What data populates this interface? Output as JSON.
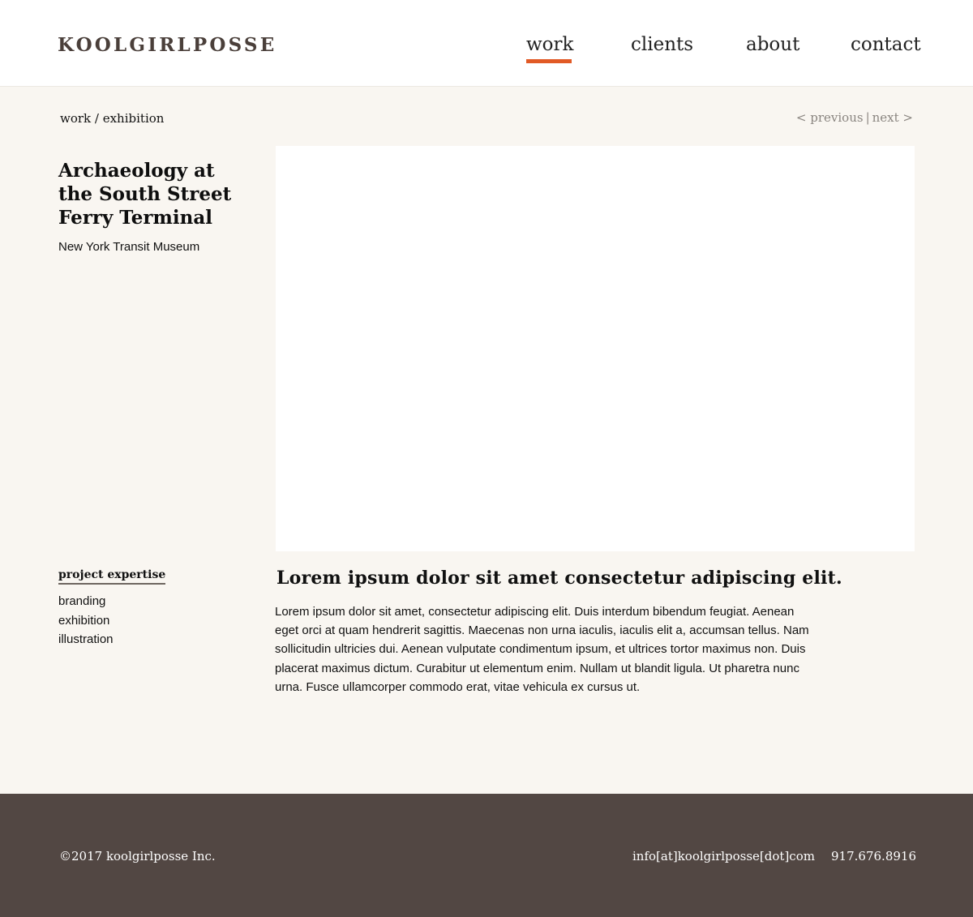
{
  "header": {
    "logo": "KOOLGIRLPOSSE",
    "nav": [
      {
        "label": "work",
        "active": true
      },
      {
        "label": "clients",
        "active": false
      },
      {
        "label": "about",
        "active": false
      },
      {
        "label": "contact",
        "active": false
      }
    ]
  },
  "breadcrumb": "work / exhibition",
  "pager": {
    "previous": "< previous",
    "separator": "|",
    "next": "next >"
  },
  "project": {
    "title": "Archaeology at the South Street Ferry Terminal",
    "client": "New York Transit Museum"
  },
  "expertise": {
    "title": "project expertise",
    "items": [
      "branding",
      "exhibition",
      "illustration"
    ]
  },
  "content": {
    "heading": "Lorem ipsum dolor sit amet consectetur adipiscing elit.",
    "body": "Lorem ipsum dolor sit amet, consectetur adipiscing elit. Duis interdum bibendum feugiat. Aenean eget orci at quam hendrerit sagittis. Maecenas non urna iaculis, iaculis elit a, accumsan tellus. Nam sollicitudin ultricies dui. Aenean vulputate condimentum ipsum, et ultrices tortor maximus non. Duis placerat maximus dictum. Curabitur ut elementum enim. Nullam ut blandit ligula. Ut pharetra nunc urna. Fusce ullamcorper commodo erat, vitae vehicula ex cursus ut."
  },
  "footer": {
    "copyright": "©2017 koolgirlposse Inc.",
    "email": "info[at]koolgirlposse[dot]com",
    "phone": "917.676.8916"
  },
  "colors": {
    "accent": "#e15a26",
    "footer_bg": "#524743",
    "page_bg": "#f9f6f1",
    "logo": "#4a3f3a"
  }
}
